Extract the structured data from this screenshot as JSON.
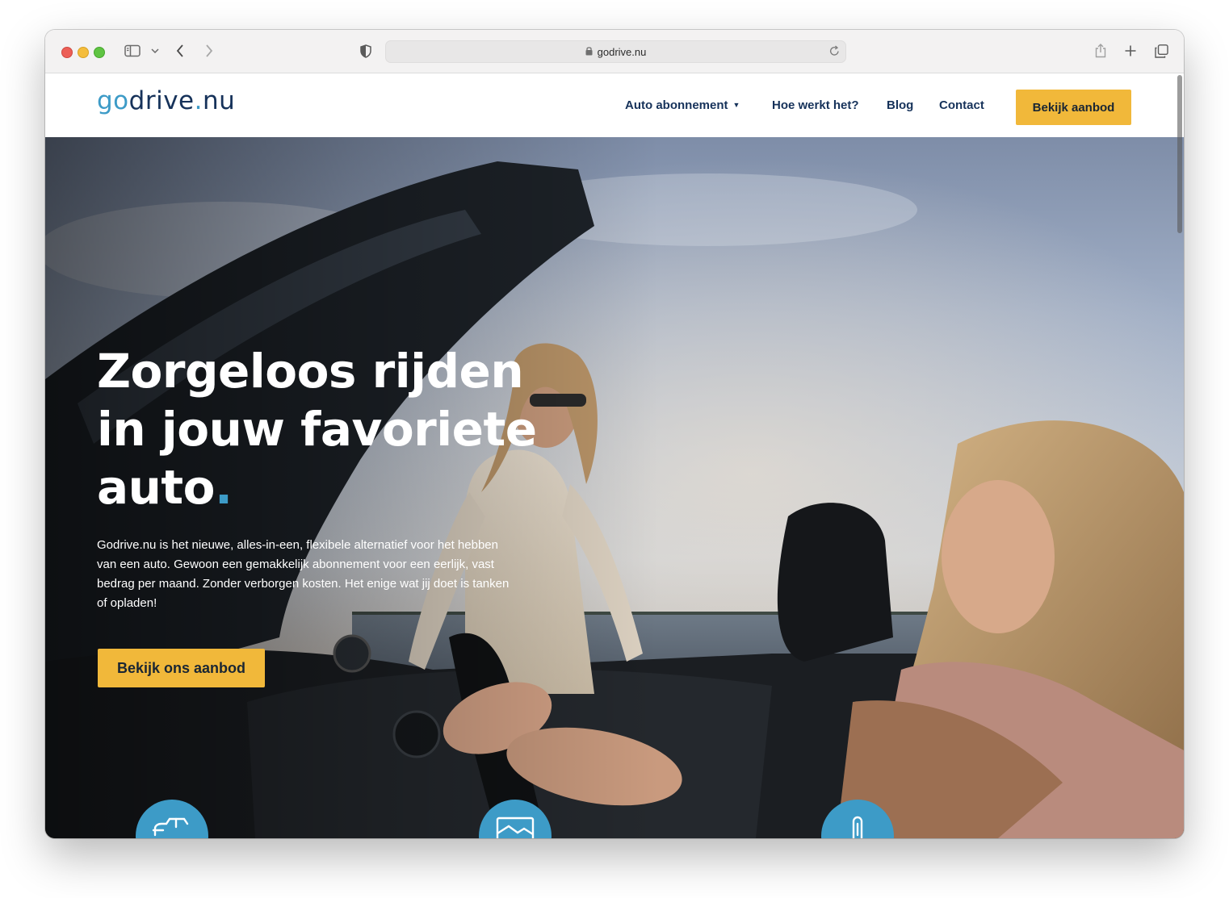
{
  "browser": {
    "url": "godrive.nu",
    "icons": [
      "sidebar-icon",
      "chevron-down-icon",
      "back-icon",
      "forward-icon",
      "shield-icon",
      "lock-icon",
      "reload-icon",
      "share-icon",
      "plus-icon",
      "tabs-icon"
    ]
  },
  "header": {
    "logo": {
      "part1": "go",
      "part2": "drive",
      "part3": ".",
      "part4": "nu"
    },
    "nav": [
      {
        "label": "Auto abonnement",
        "has_caret": true
      },
      {
        "label": "Hoe werkt het?"
      },
      {
        "label": "Blog"
      },
      {
        "label": "Contact"
      }
    ],
    "cta_label": "Bekijk aanbod"
  },
  "hero": {
    "title_line1": "Zorgeloos rijden",
    "title_line2": "in jouw favoriete",
    "title_line3": "auto",
    "title_dot": ".",
    "text": "Godrive.nu is het nieuwe, alles-in-een, flexibele alternatief voor het hebben van een auto. Gewoon een gemakkelijk abonnement voor een eerlijk, vast bedrag per maand. Zonder verborgen kosten. Het enige wat jij doet is tanken of opladen!",
    "cta_label": "Bekijk ons aanbod"
  },
  "features": [
    {
      "icon": "car-icon"
    },
    {
      "icon": "image-icon"
    },
    {
      "icon": "thermometer-icon"
    }
  ],
  "colors": {
    "accent_blue": "#3d9bc7",
    "navy": "#16325a",
    "cta_yellow": "#f1b83a"
  }
}
